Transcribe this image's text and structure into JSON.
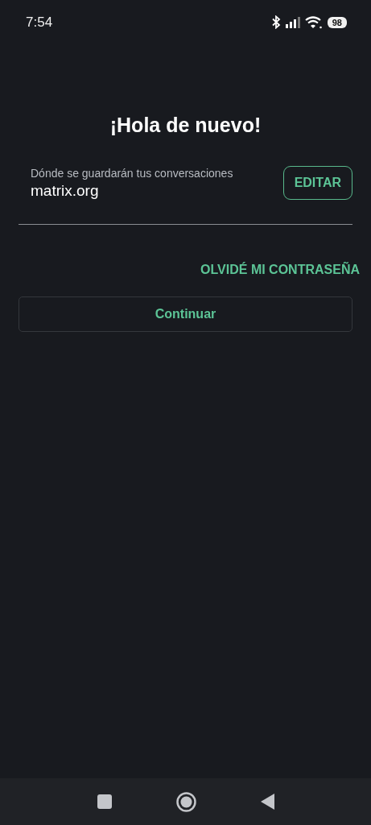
{
  "status_bar": {
    "time": "7:54",
    "battery": "98"
  },
  "title": "¡Hola de nuevo!",
  "server": {
    "label": "Dónde se guardarán tus conversaciones",
    "value": "matrix.org",
    "edit_button": "EDITAR"
  },
  "forgot_password": "OLVIDÉ MI CONTRASEÑA",
  "continue_button": "Continuar"
}
